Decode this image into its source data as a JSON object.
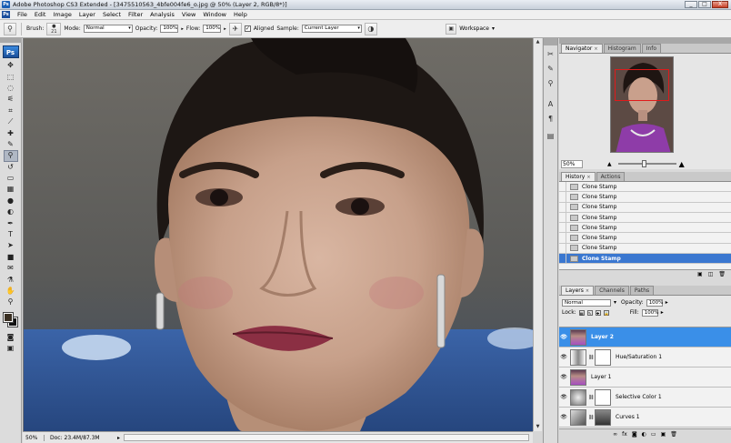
{
  "window": {
    "title": "Adobe Photoshop CS3 Extended - [3475510563_4bfe004fe6_o.jpg @ 50% (Layer 2, RGB/8*)]",
    "app_icon": "Ps",
    "minimize": "_",
    "maximize": "□",
    "close": "X"
  },
  "menubar": {
    "logo": "Ps",
    "items": [
      "File",
      "Edit",
      "Image",
      "Layer",
      "Select",
      "Filter",
      "Analysis",
      "View",
      "Window",
      "Help"
    ]
  },
  "options": {
    "brush_label": "Brush:",
    "brush_size": "21",
    "mode_label": "Mode:",
    "mode_value": "Normal",
    "opacity_label": "Opacity:",
    "opacity_value": "100%",
    "flow_label": "Flow:",
    "flow_value": "100%",
    "aligned_label": "Aligned",
    "aligned_checked": true,
    "sample_label": "Sample:",
    "sample_value": "Current Layer",
    "workspace_label": "Workspace"
  },
  "toolbox": {
    "badge": "Ps",
    "tools": [
      {
        "name": "move-tool-icon",
        "glyph": "✥"
      },
      {
        "name": "marquee-tool-icon",
        "glyph": "⬚"
      },
      {
        "name": "lasso-tool-icon",
        "glyph": "◌"
      },
      {
        "name": "magic-wand-tool-icon",
        "glyph": "⚟"
      },
      {
        "name": "crop-tool-icon",
        "glyph": "⌗"
      },
      {
        "name": "slice-tool-icon",
        "glyph": "⟋"
      },
      {
        "name": "healing-brush-tool-icon",
        "glyph": "✚"
      },
      {
        "name": "brush-tool-icon",
        "glyph": "✎"
      },
      {
        "name": "clone-stamp-tool-icon",
        "glyph": "⚲"
      },
      {
        "name": "history-brush-tool-icon",
        "glyph": "↺"
      },
      {
        "name": "eraser-tool-icon",
        "glyph": "▭"
      },
      {
        "name": "gradient-tool-icon",
        "glyph": "▦"
      },
      {
        "name": "blur-tool-icon",
        "glyph": "●"
      },
      {
        "name": "dodge-tool-icon",
        "glyph": "◐"
      },
      {
        "name": "pen-tool-icon",
        "glyph": "✒"
      },
      {
        "name": "type-tool-icon",
        "glyph": "T"
      },
      {
        "name": "path-selection-tool-icon",
        "glyph": "➤"
      },
      {
        "name": "shape-tool-icon",
        "glyph": "■"
      },
      {
        "name": "notes-tool-icon",
        "glyph": "✉"
      },
      {
        "name": "eyedropper-tool-icon",
        "glyph": "⚗"
      },
      {
        "name": "hand-tool-icon",
        "glyph": "✋"
      },
      {
        "name": "zoom-tool-icon",
        "glyph": "⚲"
      }
    ],
    "extra": [
      {
        "name": "quick-mask-icon",
        "glyph": "◙"
      },
      {
        "name": "screen-mode-icon",
        "glyph": "▣"
      }
    ],
    "foreground_color": "#3a2f22",
    "background_color": "#111111"
  },
  "status": {
    "zoom": "50%",
    "doc": "Doc: 23.4M/87.3M"
  },
  "icon_strip": [
    {
      "name": "tool-presets-icon",
      "glyph": "✂"
    },
    {
      "name": "brushes-icon",
      "glyph": "✎"
    },
    {
      "name": "clone-source-icon",
      "glyph": "⚲"
    },
    {
      "name": "character-icon",
      "glyph": "A"
    },
    {
      "name": "paragraph-icon",
      "glyph": "¶"
    },
    {
      "name": "layer-comps-icon",
      "glyph": "▤"
    }
  ],
  "navigator": {
    "tabs": [
      {
        "label": "Navigator",
        "active": true,
        "closable": true
      },
      {
        "label": "Histogram",
        "active": false,
        "closable": false
      },
      {
        "label": "Info",
        "active": false,
        "closable": false
      }
    ],
    "zoom": "50%"
  },
  "history": {
    "tabs": [
      {
        "label": "History",
        "active": true,
        "closable": true
      },
      {
        "label": "Actions",
        "active": false,
        "closable": false
      }
    ],
    "items": [
      "Clone Stamp",
      "Clone Stamp",
      "Clone Stamp",
      "Clone Stamp",
      "Clone Stamp",
      "Clone Stamp",
      "Clone Stamp",
      "Clone Stamp"
    ],
    "selected_index": 7
  },
  "layers": {
    "tabs": [
      {
        "label": "Layers",
        "active": true,
        "closable": true
      },
      {
        "label": "Channels",
        "active": false,
        "closable": false
      },
      {
        "label": "Paths",
        "active": false,
        "closable": false
      }
    ],
    "blend_mode": "Normal",
    "opacity_label": "Opacity:",
    "opacity_value": "100%",
    "lock_label": "Lock:",
    "fill_label": "Fill:",
    "fill_value": "100%",
    "items": [
      {
        "name": "Layer 2",
        "type": "photo",
        "selected": true
      },
      {
        "name": "Hue/Saturation 1",
        "type": "adjustment",
        "selected": false
      },
      {
        "name": "Layer 1",
        "type": "photo",
        "selected": false
      },
      {
        "name": "Selective Color 1",
        "type": "adjustment",
        "selected": false
      },
      {
        "name": "Curves 1",
        "type": "adjustment",
        "selected": false
      }
    ]
  }
}
